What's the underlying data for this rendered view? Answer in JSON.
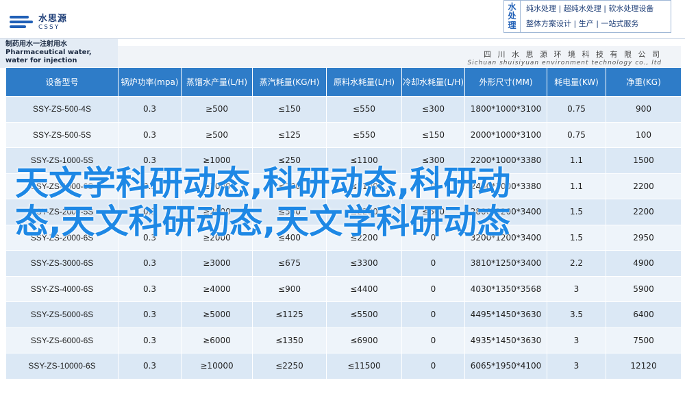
{
  "header": {
    "logo_cn": "水思源",
    "logo_en": "CSSY",
    "brand_vertical": [
      "水",
      "处",
      "理"
    ],
    "brand_line1": "纯水处理 | 超纯水处理 | 软水处理设备",
    "brand_line2": "整体方案设计 | 生产 | 一站式服务"
  },
  "product": {
    "title_cn": "制药用水一注射用水",
    "title_en": "Pharmaceutical water, water for injection",
    "company_cn": "四 川 水 思 源 环 境 科 技 有 限 公 司",
    "company_en": "Sichuan shuisiyuan environment technology co., ltd"
  },
  "table": {
    "headers": [
      "设备型号",
      "锅炉功率(mpa)",
      "蒸馏水产量(L/H)",
      "蒸汽耗量(KG/H)",
      "原料水耗量(L/H)",
      "冷却水耗量(L/H)",
      "外形尺寸(MM)",
      "耗电量(KW)",
      "净重(KG)"
    ],
    "rows": [
      [
        "SSY-ZS-500-4S",
        "0.3",
        "≥500",
        "≤150",
        "≤550",
        "≤300",
        "1800*1000*3100",
        "0.75",
        "900"
      ],
      [
        "SSY-ZS-500-5S",
        "0.3",
        "≥500",
        "≤125",
        "≤550",
        "≤150",
        "2000*1000*3100",
        "0.75",
        "100"
      ],
      [
        "SSY-ZS-1000-5S",
        "0.3",
        "≥1000",
        "≤250",
        "≤1100",
        "≤300",
        "2200*1000*3380",
        "1.1",
        "1500"
      ],
      [
        "SSY-ZS-1000-6S",
        "0.3",
        "≥1000",
        "≤200",
        "≤1100",
        "0",
        "2450*1000*3380",
        "1.1",
        "2200"
      ],
      [
        "SSY-ZS-2000-5S",
        "0.3",
        "≥2000",
        "≤500",
        "≤2200",
        "≤600",
        "2800*1200*3400",
        "1.5",
        "2200"
      ],
      [
        "SSY-ZS-2000-6S",
        "0.3",
        "≥2000",
        "≤400",
        "≤2200",
        "0",
        "3200*1200*3400",
        "1.5",
        "2950"
      ],
      [
        "SSY-ZS-3000-6S",
        "0.3",
        "≥3000",
        "≤675",
        "≤3300",
        "0",
        "3810*1250*3400",
        "2.2",
        "4900"
      ],
      [
        "SSY-ZS-4000-6S",
        "0.3",
        "≥4000",
        "≤900",
        "≤4400",
        "0",
        "4030*1350*3568",
        "3",
        "5900"
      ],
      [
        "SSY-ZS-5000-6S",
        "0.3",
        "≥5000",
        "≤1125",
        "≤5500",
        "0",
        "4495*1450*3630",
        "3.5",
        "6400"
      ],
      [
        "SSY-ZS-6000-6S",
        "0.3",
        "≥6000",
        "≤1350",
        "≤6900",
        "0",
        "4935*1450*3630",
        "3",
        "7500"
      ],
      [
        "SSY-ZS-10000-6S",
        "0.3",
        "≥10000",
        "≤2250",
        "≤11500",
        "0",
        "6065*1950*4100",
        "3",
        "12120"
      ]
    ]
  },
  "watermark": {
    "line1": "天文学科研动态,科研动态,科研动",
    "line2": "态,天文科研动态,天文学科研动态"
  }
}
